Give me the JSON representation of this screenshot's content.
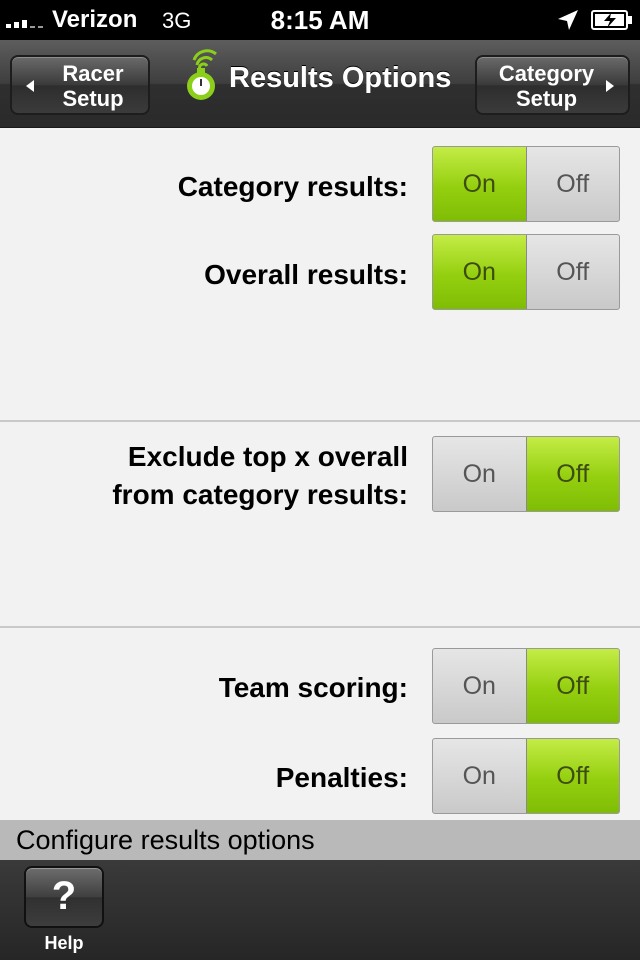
{
  "status_bar": {
    "carrier": "Verizon",
    "network": "3G",
    "time": "8:15 AM",
    "location_icon": "location-arrow-icon",
    "battery_icon": "battery-charging-icon"
  },
  "nav": {
    "back_label": "Racer Setup",
    "title": "Results Options",
    "forward_label": "Category Setup",
    "logo_icon": "stopwatch-signal-icon"
  },
  "settings": [
    {
      "label": "Category results:",
      "on_label": "On",
      "off_label": "Off",
      "value": "On"
    },
    {
      "label": "Overall results:",
      "on_label": "On",
      "off_label": "Off",
      "value": "On"
    },
    {
      "label": "Exclude top x overall from category results:",
      "on_label": "On",
      "off_label": "Off",
      "value": "Off"
    },
    {
      "label": "Team scoring:",
      "on_label": "On",
      "off_label": "Off",
      "value": "Off"
    },
    {
      "label": "Penalties:",
      "on_label": "On",
      "off_label": "Off",
      "value": "Off"
    }
  ],
  "hint": "Configure results options",
  "toolbar": {
    "help_label": "Help",
    "help_icon": "question-mark-icon"
  },
  "colors": {
    "accent_green": "#94cf0f",
    "background": "#f2f2f2"
  }
}
